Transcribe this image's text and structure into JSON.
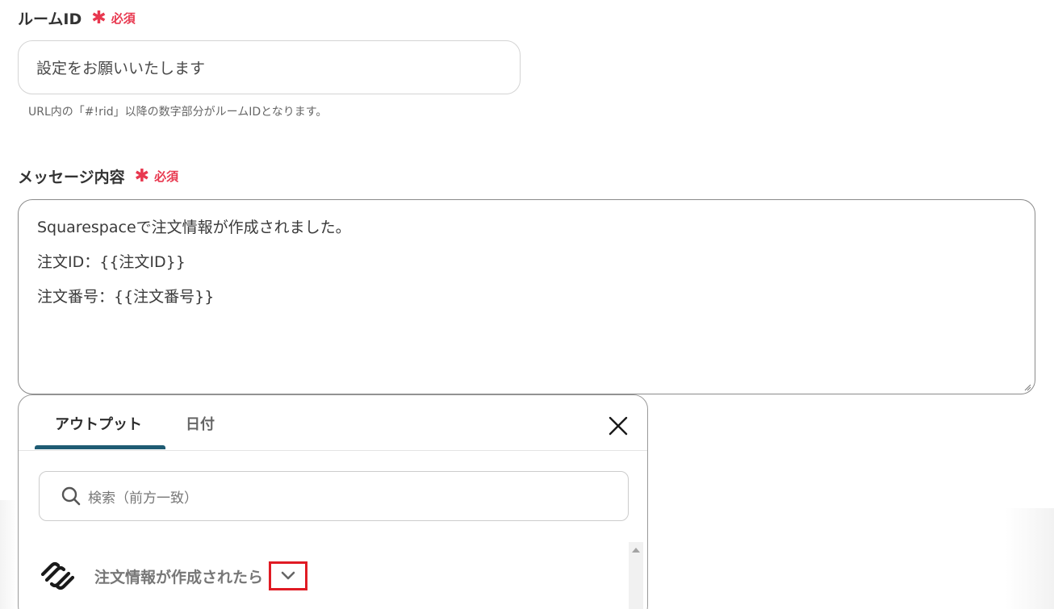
{
  "room_id": {
    "label": "ルームID",
    "required_label": "必須",
    "required_mark": "✱",
    "value": "設定をお願いいたします",
    "help": "URL内の「#!rid」以降の数字部分がルームIDとなります。"
  },
  "message": {
    "label": "メッセージ内容",
    "required_label": "必須",
    "required_mark": "✱",
    "lines": [
      "Squarespaceで注文情報が作成されました。",
      "注文ID：{{注文ID}}",
      "注文番号：{{注文番号}}"
    ]
  },
  "panel": {
    "tabs": [
      {
        "label": "アウトプット",
        "active": true
      },
      {
        "label": "日付",
        "active": false
      }
    ],
    "search_placeholder": "検索（前方一致）",
    "section_title": "注文情報が作成されたら",
    "section_icon": "squarespace-logo-icon"
  },
  "colors": {
    "required": "#e8384f",
    "tab_active": "#1e5b73",
    "highlight": "#e01b24"
  }
}
